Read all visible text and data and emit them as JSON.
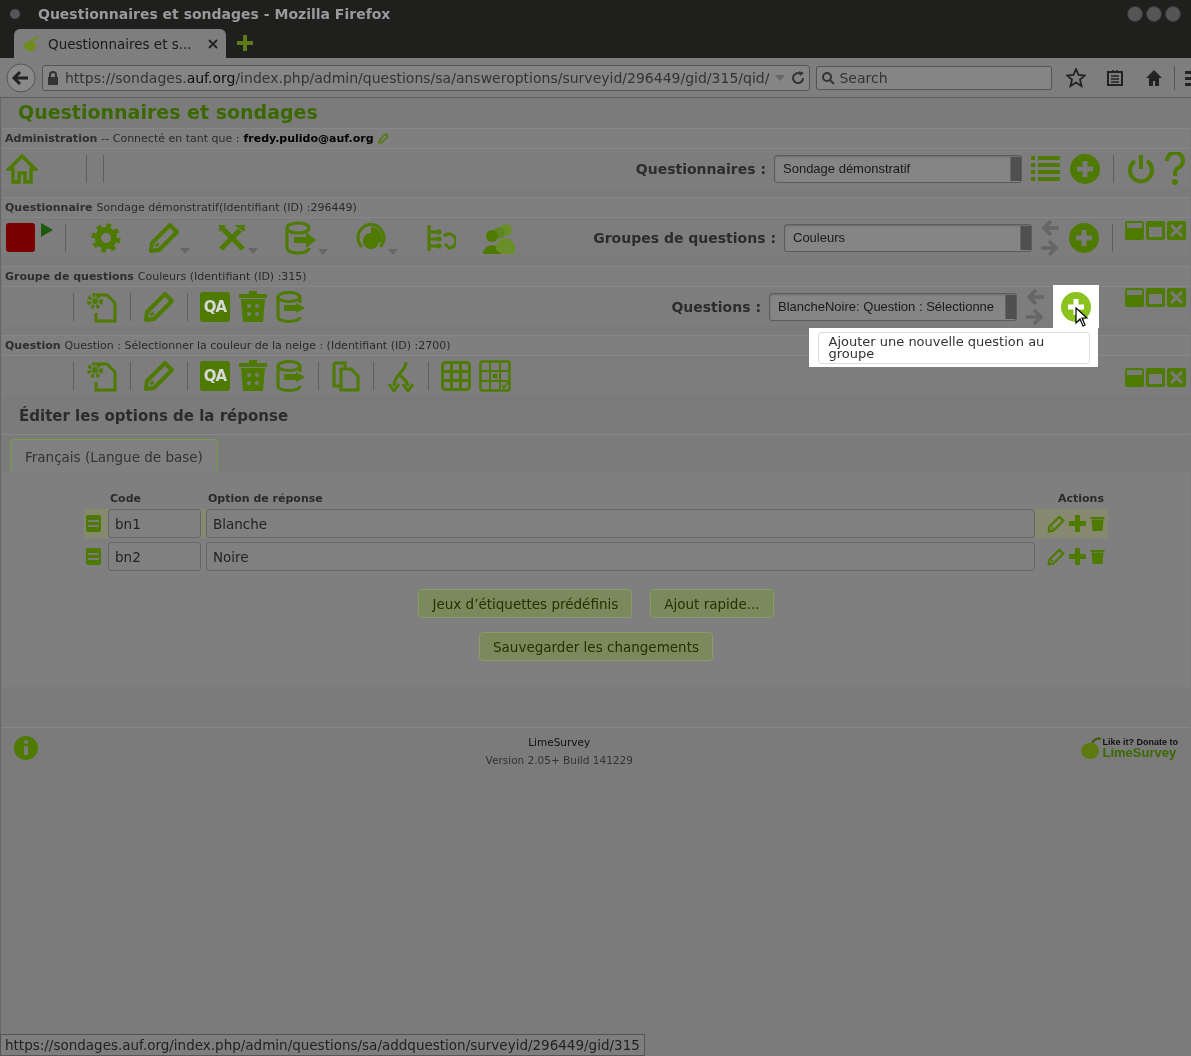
{
  "window": {
    "title": "Questionnaires et sondages - Mozilla Firefox"
  },
  "browser": {
    "tabs": [
      {
        "label": "Questionnaires et s...",
        "selected": true
      }
    ],
    "url_prefix": "https://sondages.",
    "url_domain": "auf.org",
    "url_rest": "/index.php/admin/questions/sa/answeroptions/surveyid/296449/gid/315/qid/",
    "search": {
      "placeholder": "Search"
    }
  },
  "header": {
    "title": "Questionnaires et sondages"
  },
  "admin_bar": {
    "label": "Administration",
    "text": "-- Connecté en tant que :",
    "user": "fredy.pulido@auf.org"
  },
  "surveys_toolbar": {
    "label": "Questionnaires :",
    "value": "Sondage démonstratif"
  },
  "survey_bar": {
    "label": "Questionnaire",
    "text": "Sondage démonstratif(Identifiant (ID) :296449)"
  },
  "groups_toolbar": {
    "label": "Groupes de questions :",
    "value": "Couleurs"
  },
  "group_bar": {
    "label": "Groupe de questions",
    "text": "Couleurs (Identifiant (ID) :315)",
    "qa_icon": "QA"
  },
  "questions_toolbar": {
    "label": "Questions :",
    "value": "BlancheNoire: Question : Sélectionne",
    "add_hovered": true
  },
  "tooltip": {
    "text": "Ajouter une nouvelle question au groupe"
  },
  "question_bar": {
    "label": "Question",
    "text": "Question : Sélectionner la couleur de la neige : (Identifiant (ID) :2700)",
    "qa_icon": "QA"
  },
  "editor": {
    "title": "Éditer les options de la réponse",
    "tabs": [
      {
        "label": "Français (Langue de base)",
        "selected": true
      }
    ],
    "columns": [
      "Code",
      "Option de réponse",
      "Actions"
    ],
    "rows": [
      {
        "code": "bn1",
        "answer": "Blanche",
        "highlighted": true
      },
      {
        "code": "bn2",
        "answer": "Noire",
        "highlighted": false
      }
    ],
    "buttons": [
      "Jeux d’étiquettes prédéfinis",
      "Ajout rapide..."
    ],
    "save_button": "Sauvegarder les changements"
  },
  "footer": {
    "name": "LimeSurvey",
    "version": "Version 2.05+ Build 141229",
    "donate": "Like it? Donate to",
    "donate_brand": "LimeSurvey"
  },
  "status_bar": {
    "url": "https://sondages.auf.org/index.php/admin/questions/sa/addquestion/surveyid/296449/gid/315"
  }
}
